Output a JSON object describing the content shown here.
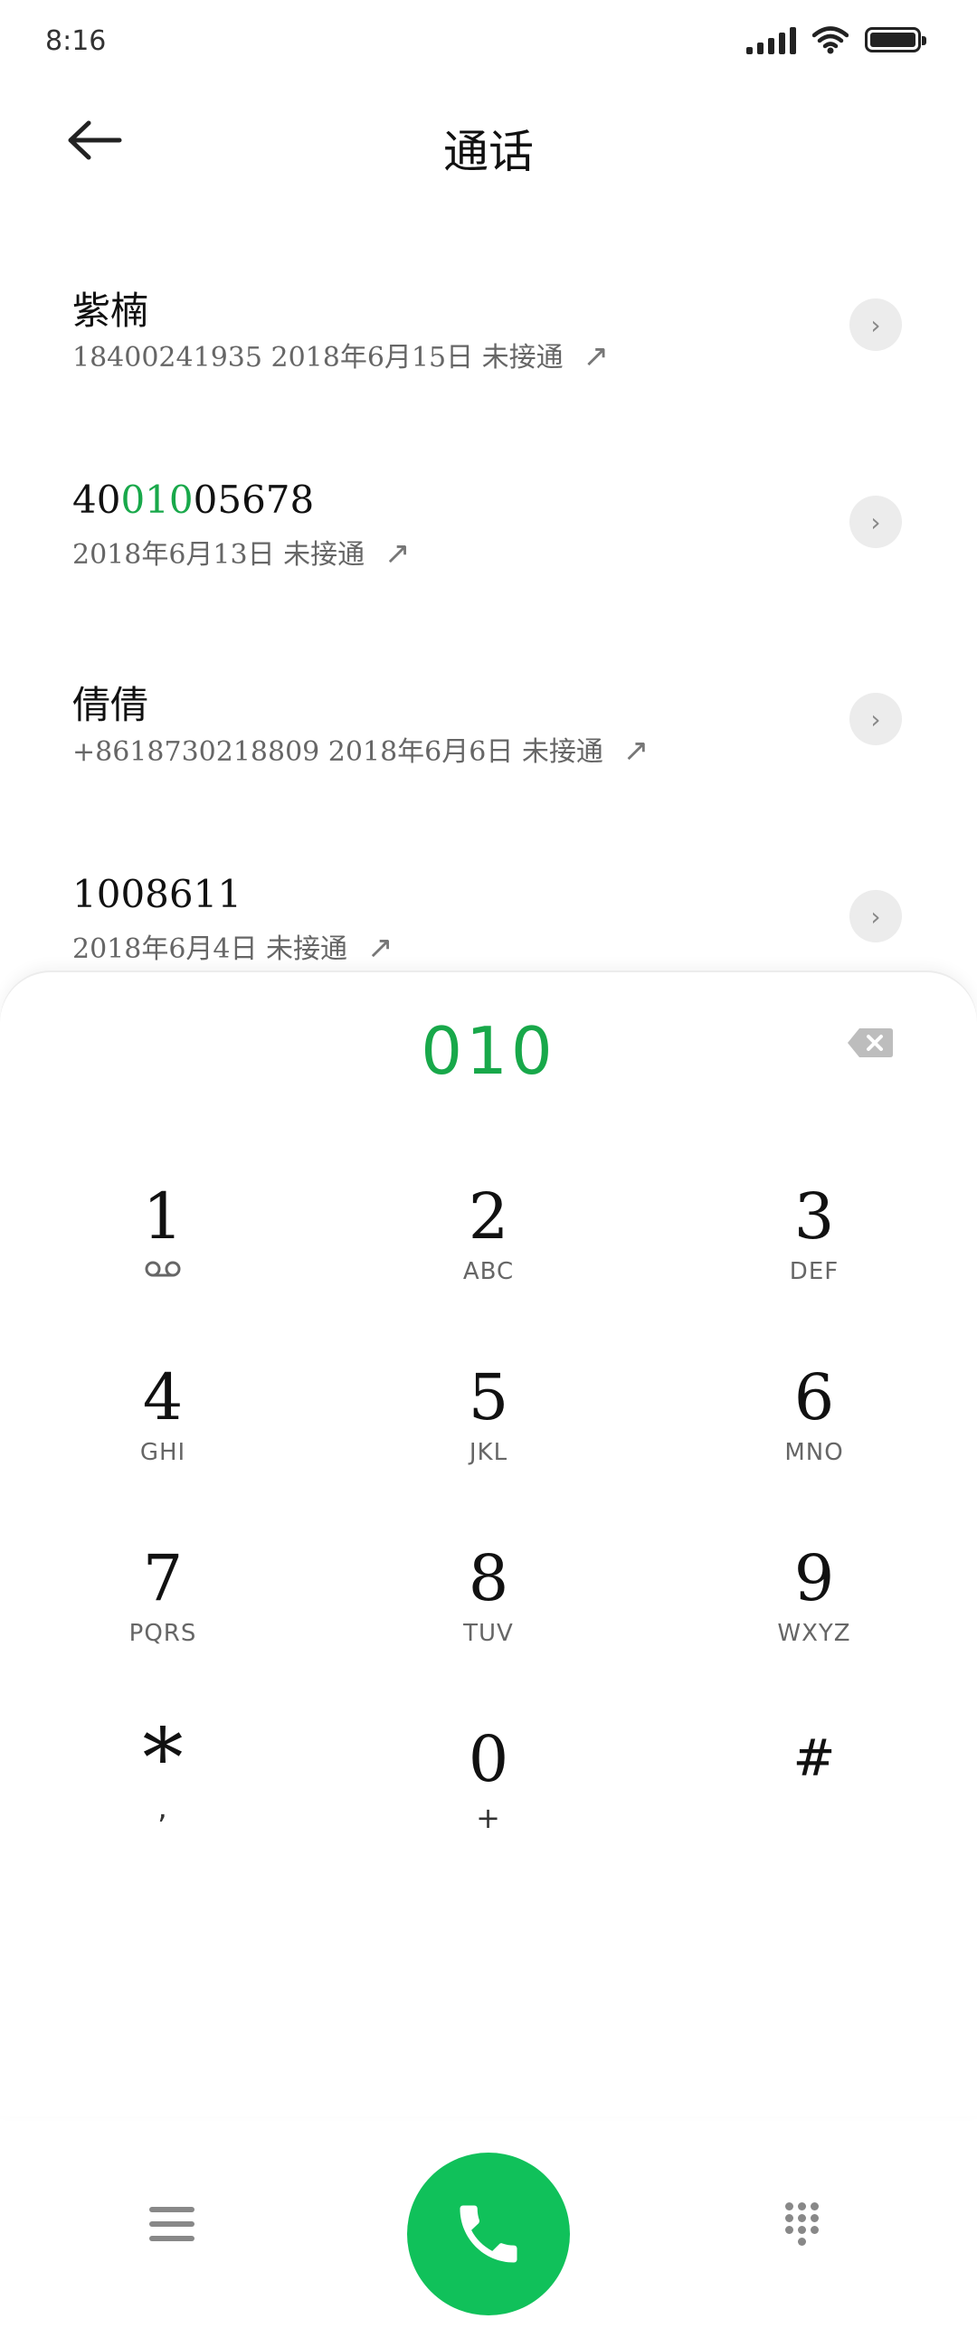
{
  "status": {
    "time": "8:16"
  },
  "header": {
    "title": "通话"
  },
  "log": [
    {
      "name": "紫楠",
      "meta": "18400241935 2018年6月15日 未接通"
    },
    {
      "name_pre": "40",
      "name_hl": "010",
      "name_post": "05678",
      "meta": "2018年6月13日 未接通"
    },
    {
      "name": "倩倩",
      "meta": "+8618730218809 2018年6月6日 未接通"
    },
    {
      "name": "1008611",
      "meta": "2018年6月4日 未接通"
    }
  ],
  "dialer": {
    "input": "010",
    "keys": [
      {
        "num": "1",
        "sub": ""
      },
      {
        "num": "2",
        "sub": "ABC"
      },
      {
        "num": "3",
        "sub": "DEF"
      },
      {
        "num": "4",
        "sub": "GHI"
      },
      {
        "num": "5",
        "sub": "JKL"
      },
      {
        "num": "6",
        "sub": "MNO"
      },
      {
        "num": "7",
        "sub": "PQRS"
      },
      {
        "num": "8",
        "sub": "TUV"
      },
      {
        "num": "9",
        "sub": "WXYZ"
      },
      {
        "num": "*",
        "sub": ","
      },
      {
        "num": "0",
        "sub": "+"
      },
      {
        "num": "#",
        "sub": ""
      }
    ]
  },
  "colors": {
    "accent": "#18a84a",
    "call_button": "#10c15a"
  }
}
